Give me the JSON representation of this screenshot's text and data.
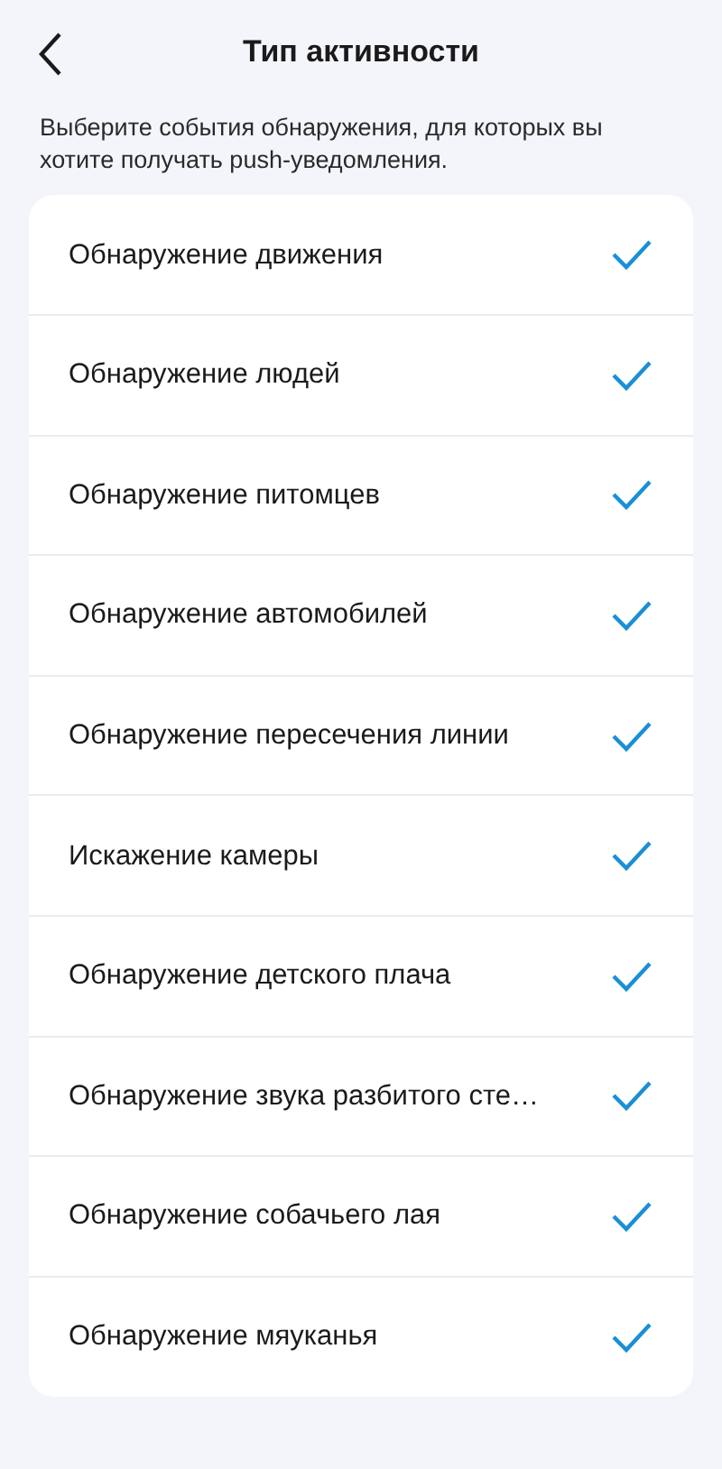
{
  "header": {
    "title": "Тип активности"
  },
  "description": "Выберите события обнаружения, для которых вы хотите получать push-уведомления.",
  "items": [
    {
      "label": "Обнаружение движения",
      "checked": true
    },
    {
      "label": "Обнаружение людей",
      "checked": true
    },
    {
      "label": "Обнаружение питомцев",
      "checked": true
    },
    {
      "label": "Обнаружение автомобилей",
      "checked": true
    },
    {
      "label": "Обнаружение пересечения линии",
      "checked": true
    },
    {
      "label": "Искажение камеры",
      "checked": true
    },
    {
      "label": "Обнаружение детского плача",
      "checked": true
    },
    {
      "label": "Обнаружение звука разбитого сте…",
      "checked": true
    },
    {
      "label": "Обнаружение собачьего лая",
      "checked": true
    },
    {
      "label": "Обнаружение мяуканья",
      "checked": true
    }
  ]
}
